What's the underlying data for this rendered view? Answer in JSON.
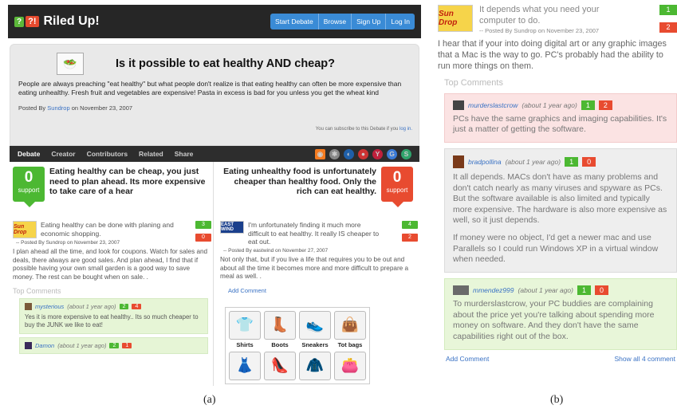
{
  "panel_a": {
    "app_title": "Riled Up!",
    "logo_q": "?",
    "logo_ex": "?!",
    "nav": [
      "Start Debate",
      "Browse",
      "Sign Up",
      "Log In"
    ],
    "question": {
      "title": "Is it possible to eat healthy AND cheap?",
      "body": "People are always preaching \"eat healthy\" but what people don't realize is that eating healthy can often be more expensive than eating unhealthy. Fresh fruit and vegetables are expensive! Pasta in excess is bad for you unless you get the wheat kind",
      "posted_prefix": "Posted By",
      "author": "Sundrop",
      "date": "on November 23, 2007",
      "subscribe": "You can subscribe to this Debate if you",
      "subscribe_link": "log in."
    },
    "tabs": [
      "Debate",
      "Creator",
      "Contributors",
      "Related",
      "Share"
    ],
    "left": {
      "count": "0",
      "support": "support",
      "side_text": "Eating healthy can be cheap, you just need to plan ahead. Its more expensive to take care of a hear",
      "avatar": "Sun Drop",
      "arg_text": "Eating healthy can be done with planing and economic shopping.",
      "vote_up": "3",
      "vote_down": "0",
      "arg_meta": "-- Posted By Sundrop on November 23, 2007",
      "arg_body": "I plan ahead all the time, and look for coupons. Watch for sales and deals, there always are good sales. And plan ahead, I find that if possible having your own small garden is a good way to save money. The rest can be bought when on sale. .",
      "top_comments": "Top Comments",
      "comments": [
        {
          "user": "mysterious",
          "when": "(about 1 year ago)",
          "up": "2",
          "down": "4",
          "body": "Yes it is more expensive to eat healthy.. Its so much cheaper to buy the JUNK we like to eat!"
        },
        {
          "user": "Damon",
          "when": "(about 1 year ago)",
          "up": "2",
          "down": "1",
          "body": ""
        }
      ]
    },
    "right": {
      "count": "0",
      "support": "support",
      "side_text": "Eating unhealthy food is unfortunately cheaper than healthy food. Only the rich can eat healthy.",
      "avatar": "EAST WIND",
      "arg_text": "I'm unfortunately finding it much more difficult to eat healthy. It really IS cheaper to eat out.",
      "vote_up": "4",
      "vote_down": "2",
      "arg_meta": "-- Posted By eastwind on November 27, 2007",
      "arg_body": "Not only that, but if you live a life that requires you to be out and about all the time it becomes more and more difficult to prepare a meal as well. .",
      "add_comment": "Add Comment",
      "ads": [
        "Shirts",
        "Boots",
        "Sneakers",
        "Tot bags"
      ]
    }
  },
  "panel_b": {
    "avatar": "Sun Drop",
    "head_text": "It depends what you need your computer to do.",
    "head_meta": "-- Posted By Sundrop on November 23, 2007",
    "vote_up": "1",
    "vote_down": "2",
    "body": "I hear that if your into doing digital art or any graphic images that a Mac is the way to go. PC's probably had the ability to run more things on them.",
    "top_comments": "Top Comments",
    "comments": [
      {
        "user": "murderslastcrow",
        "when": "(about 1 year ago)",
        "up": "1",
        "down": "2",
        "body": "PCs have the same graphics and imaging capabilities. It's just a matter of getting the software."
      },
      {
        "user": "bradpollina",
        "when": "(about 1 year ago)",
        "up": "1",
        "down": "0",
        "body": "It all depends. MACs don't have as many problems and don't catch nearly as many viruses and spyware as PCs. But the software available is also limited and typically more expensive. The hardware is also more expensive as well, so it just depends.",
        "body2": "If money were no object, I'd get a newer mac and use Parallels so I could run Windows XP in a virtual window when needed."
      },
      {
        "user": "mmendez999",
        "when": "(about 1 year ago)",
        "up": "1",
        "down": "0",
        "body": "To murderslastcrow, your PC buddies are complaining about the price yet you're talking about spending more money on software. And they don't have the same capabilities right out of the box."
      }
    ],
    "add_comment": "Add Comment",
    "show_all": "Show all 4 comment"
  },
  "captions": [
    "(a)",
    "(b)"
  ]
}
